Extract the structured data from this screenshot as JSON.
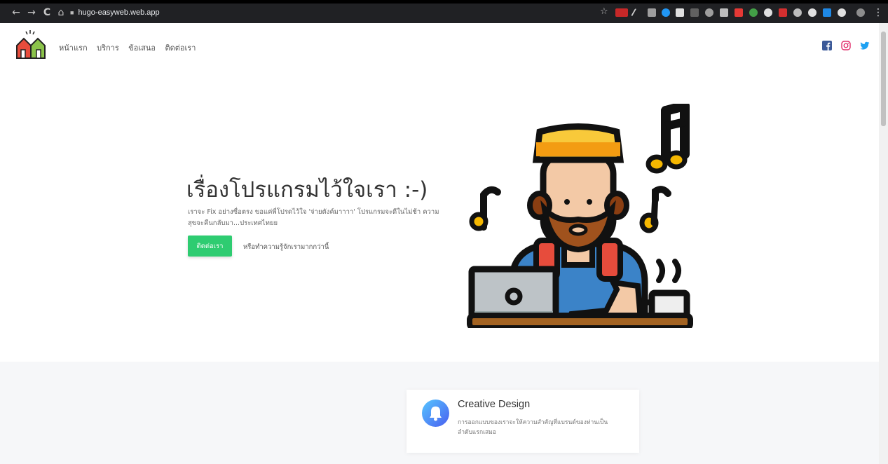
{
  "browser": {
    "url": "hugo-easyweb.web.app",
    "back_glyph": "←",
    "forward_glyph": "→",
    "reload_glyph": "C",
    "home_glyph": "⌂",
    "bookmark_glyph": "☆",
    "menu_glyph": "⋮"
  },
  "nav": {
    "items": [
      "หน้าแรก",
      "บริการ",
      "ข้อเสนอ",
      "ติดต่อเรา"
    ]
  },
  "social": {
    "icons": [
      "facebook-icon",
      "instagram-icon",
      "twitter-icon"
    ],
    "colors": {
      "facebook": "#3b5998",
      "instagram": "#e1306c",
      "twitter": "#1da1f2"
    }
  },
  "hero": {
    "title": "เรื่องโปรแกรมไว้ใจเรา :-)",
    "description": "เราจะ Fix อย่างซื่อตรง ขอแค่พี่โปรดไว้ใจ 'จ่ายตังค์มาาาา' โปรแกรมจะดีในไม่ช้า ความสุขจะคืนกลับมา...ประเทศไทยย",
    "cta_label": "ติดต่อเรา",
    "secondary_link": "หรือทำความรู้จักเรามากกว่านี้"
  },
  "feature": {
    "title": "Creative Design",
    "description": "การออกแบบของเราจะให้ความสำคัญที่แบรนด์ของท่านเป็นลำดับแรกเสมอ",
    "icon": "bell-icon"
  },
  "colors": {
    "accent_green": "#2ecc71",
    "browser_bar": "#202124",
    "section_bg": "#f6f7f9"
  }
}
